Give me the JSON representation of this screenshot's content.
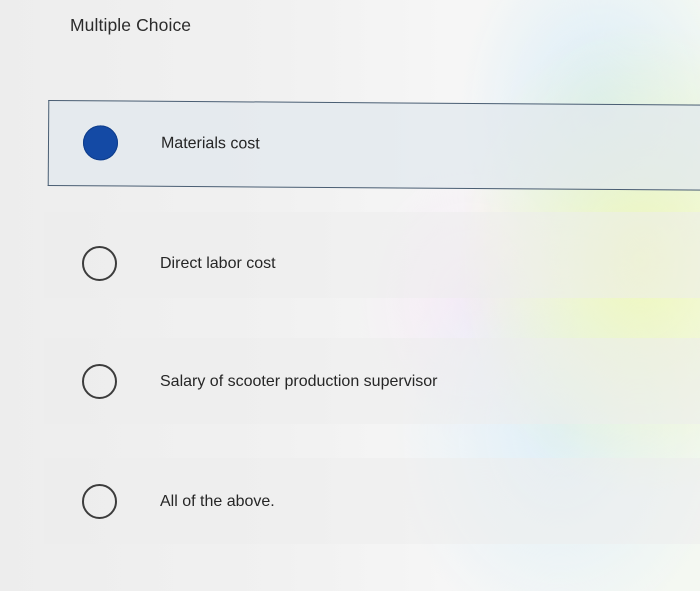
{
  "question": {
    "title": "Multiple Choice"
  },
  "options": [
    {
      "label": "Materials cost",
      "selected": true
    },
    {
      "label": "Direct labor cost",
      "selected": false
    },
    {
      "label": "Salary of scooter production supervisor",
      "selected": false
    },
    {
      "label": "All of the above.",
      "selected": false
    }
  ],
  "colors": {
    "selected_radio": "#144aa5",
    "selected_border": "#4a5e73",
    "text": "#262626"
  }
}
